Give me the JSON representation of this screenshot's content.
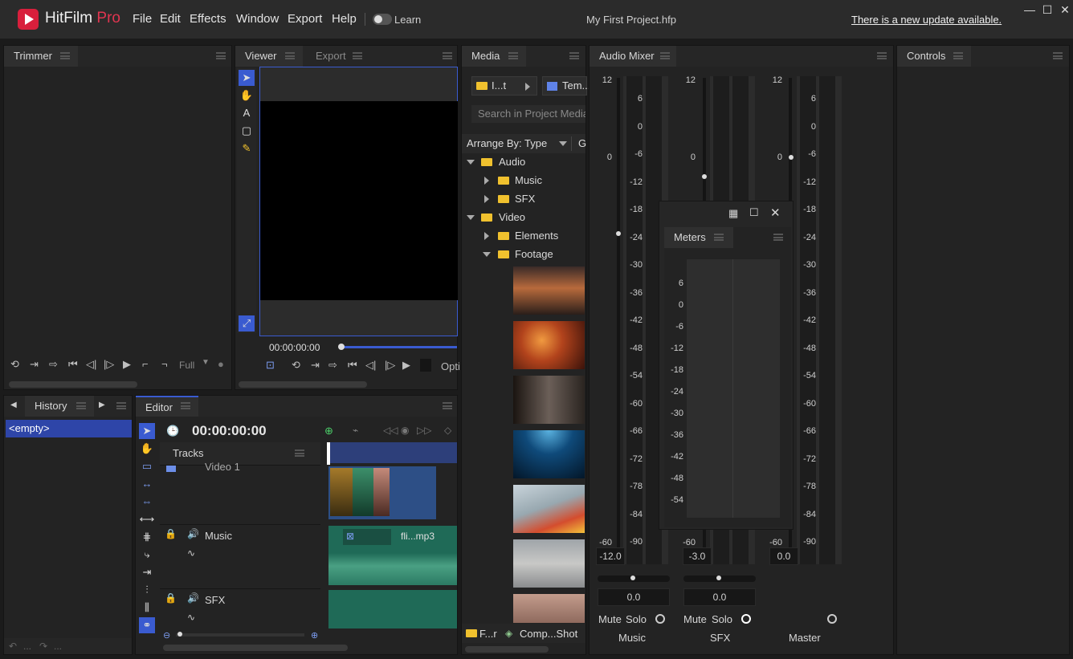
{
  "app": {
    "brand": "HitFilm",
    "brand_suffix": "Pro",
    "project_title": "My First Project.hfp",
    "update_notice": "There is a new update available.",
    "learn_label": "Learn",
    "menu": [
      "File",
      "Edit",
      "Effects",
      "Window",
      "Export",
      "Help"
    ]
  },
  "trimmer": {
    "tab": "Trimmer",
    "quality": "Full"
  },
  "viewer": {
    "tabs": [
      "Viewer",
      "Export"
    ],
    "timecode": "00:00:00:00",
    "options_label": "Opti"
  },
  "media": {
    "tab": "Media",
    "breadcrumb": [
      "I...t",
      "Tem..."
    ],
    "search_placeholder": "Search in Project Media",
    "arrange_label": "Arrange By: Type",
    "arrange_extra": "G",
    "tree": [
      {
        "label": "Audio",
        "level": 0,
        "expanded": true
      },
      {
        "label": "Music",
        "level": 1,
        "expanded": false
      },
      {
        "label": "SFX",
        "level": 1,
        "expanded": false
      },
      {
        "label": "Video",
        "level": 0,
        "expanded": true
      },
      {
        "label": "Elements",
        "level": 1,
        "expanded": false
      },
      {
        "label": "Footage",
        "level": 1,
        "expanded": true
      }
    ],
    "footer_left": "F...r",
    "footer_right": "Comp...Shot"
  },
  "audio_mixer": {
    "tab": "Audio Mixer",
    "channels": [
      {
        "name": "Music",
        "level": "-12.0",
        "pan": "0.0",
        "mute": "Mute",
        "solo": "Solo"
      },
      {
        "name": "SFX",
        "level": "-3.0",
        "pan": "0.0",
        "mute": "Mute",
        "solo": "Solo"
      },
      {
        "name": "Master",
        "level": "0.0"
      }
    ],
    "fader_ticks": [
      "12",
      "0",
      "-60"
    ],
    "meter_ticks": [
      "6",
      "0",
      "-6",
      "-12",
      "-18",
      "-24",
      "-30",
      "-36",
      "-42",
      "-48",
      "-54",
      "-60",
      "-66",
      "-72",
      "-78",
      "-84",
      "-90"
    ]
  },
  "meters": {
    "tab": "Meters",
    "ticks": [
      "6",
      "0",
      "-6",
      "-12",
      "-18",
      "-24",
      "-30",
      "-36",
      "-42",
      "-48",
      "-54"
    ]
  },
  "controls": {
    "tab": "Controls"
  },
  "history": {
    "tab": "History",
    "items": [
      "<empty>"
    ],
    "undo": "...",
    "redo": "..."
  },
  "editor": {
    "tab": "Editor",
    "timecode": "00:00:00:00",
    "tracks_label": "Tracks",
    "tracks": [
      {
        "name": "Video 1",
        "clip": ""
      },
      {
        "name": "Music",
        "clip": "fli...mp3"
      },
      {
        "name": "SFX",
        "clip": ""
      }
    ]
  },
  "colors": {
    "accent": "#3a5bd0",
    "brand_red": "#d81f3c",
    "folder": "#f0c12e",
    "video_clip": "#2d4f86",
    "audio_clip": "#1f6a57"
  }
}
